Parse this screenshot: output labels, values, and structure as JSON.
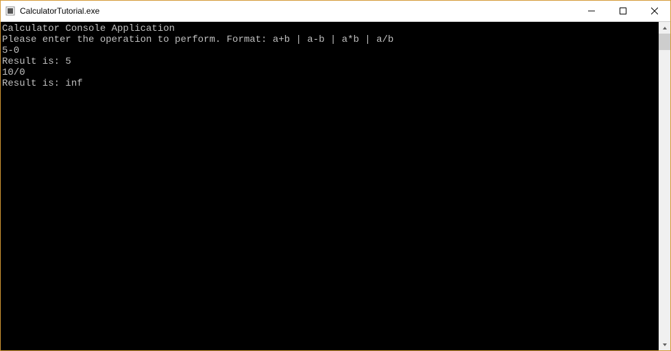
{
  "window": {
    "title": "CalculatorTutorial.exe"
  },
  "console": {
    "lines": [
      "Calculator Console Application",
      "",
      "Please enter the operation to perform. Format: a+b | a-b | a*b | a/b",
      "5-0",
      "Result is: 5",
      "10/0",
      "Result is: inf"
    ]
  }
}
